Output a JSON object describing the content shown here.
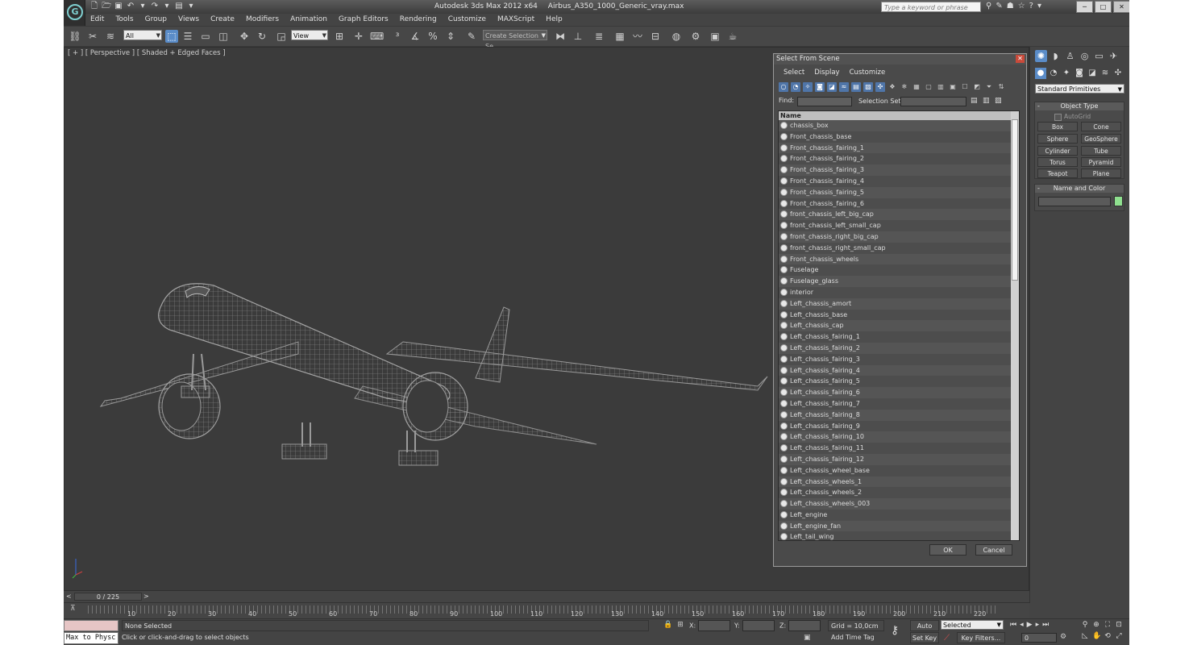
{
  "titlebar": {
    "app_title": "Autodesk 3ds Max  2012 x64",
    "file_name": "Airbus_A350_1000_Generic_vray.max",
    "search_placeholder": "Type a keyword or phrase"
  },
  "menubar": [
    "Edit",
    "Tools",
    "Group",
    "Views",
    "Create",
    "Modifiers",
    "Animation",
    "Graph Editors",
    "Rendering",
    "Customize",
    "MAXScript",
    "Help"
  ],
  "toolbar": {
    "selection_filter": "All",
    "ref_coord": "View",
    "named_selection_placeholder": "Create Selection Se"
  },
  "viewport": {
    "label": "[ + ] [ Perspective ] [ Shaded + Edged Faces ]"
  },
  "dialog": {
    "title": "Select From Scene",
    "menu": [
      "Select",
      "Display",
      "Customize"
    ],
    "find_label": "Find:",
    "selection_set_label": "Selection Set:",
    "column_header": "Name",
    "items": [
      "chassis_box",
      "Front_chassis_base",
      "Front_chassis_fairing_1",
      "Front_chassis_fairing_2",
      "Front_chassis_fairing_3",
      "Front_chassis_fairing_4",
      "Front_chassis_fairing_5",
      "Front_chassis_fairing_6",
      "front_chassis_left_big_cap",
      "front_chassis_left_small_cap",
      "front_chassis_right_big_cap",
      "front_chassis_right_small_cap",
      "Front_chassis_wheels",
      "Fuselage",
      "Fuselage_glass",
      "interior",
      "Left_chassis_amort",
      "Left_chassis_base",
      "Left_chassis_cap",
      "Left_chassis_fairing_1",
      "Left_chassis_fairing_2",
      "Left_chassis_fairing_3",
      "Left_chassis_fairing_4",
      "Left_chassis_fairing_5",
      "Left_chassis_fairing_6",
      "Left_chassis_fairing_7",
      "Left_chassis_fairing_8",
      "Left_chassis_fairing_9",
      "Left_chassis_fairing_10",
      "Left_chassis_fairing_11",
      "Left_chassis_fairing_12",
      "Left_chassis_wheel_base",
      "Left_chassis_wheels_1",
      "Left_chassis_wheels_2",
      "Left_chassis_wheels_003",
      "Left_engine",
      "Left_engine_fan",
      "Left_tail_wing"
    ],
    "ok_label": "OK",
    "cancel_label": "Cancel"
  },
  "command_panel": {
    "dropdown": "Standard Primitives",
    "object_type_title": "Object Type",
    "autogrid_label": "AutoGrid",
    "primitives": [
      "Box",
      "Cone",
      "Sphere",
      "GeoSphere",
      "Cylinder",
      "Tube",
      "Torus",
      "Pyramid",
      "Teapot",
      "Plane"
    ],
    "name_color_title": "Name and Color",
    "object_color": "#8fe08f"
  },
  "timeline": {
    "frame_display": "0 / 225",
    "tick_labels": [
      "10",
      "20",
      "30",
      "40",
      "50",
      "60",
      "70",
      "80",
      "90",
      "100",
      "110",
      "120",
      "130",
      "140",
      "150",
      "160",
      "170",
      "180",
      "190",
      "200",
      "210",
      "220"
    ]
  },
  "status": {
    "maxscript_text": "Max to Physc",
    "selection_status": "None Selected",
    "prompt": "Click or click-and-drag to select objects",
    "x_label": "X:",
    "y_label": "Y:",
    "z_label": "Z:",
    "grid": "Grid = 10,0cm",
    "add_time_tag": "Add Time Tag",
    "auto_key": "Auto Key",
    "set_key": "Set Key",
    "key_mode": "Selected",
    "key_filters": "Key Filters...",
    "current_frame": "0"
  }
}
